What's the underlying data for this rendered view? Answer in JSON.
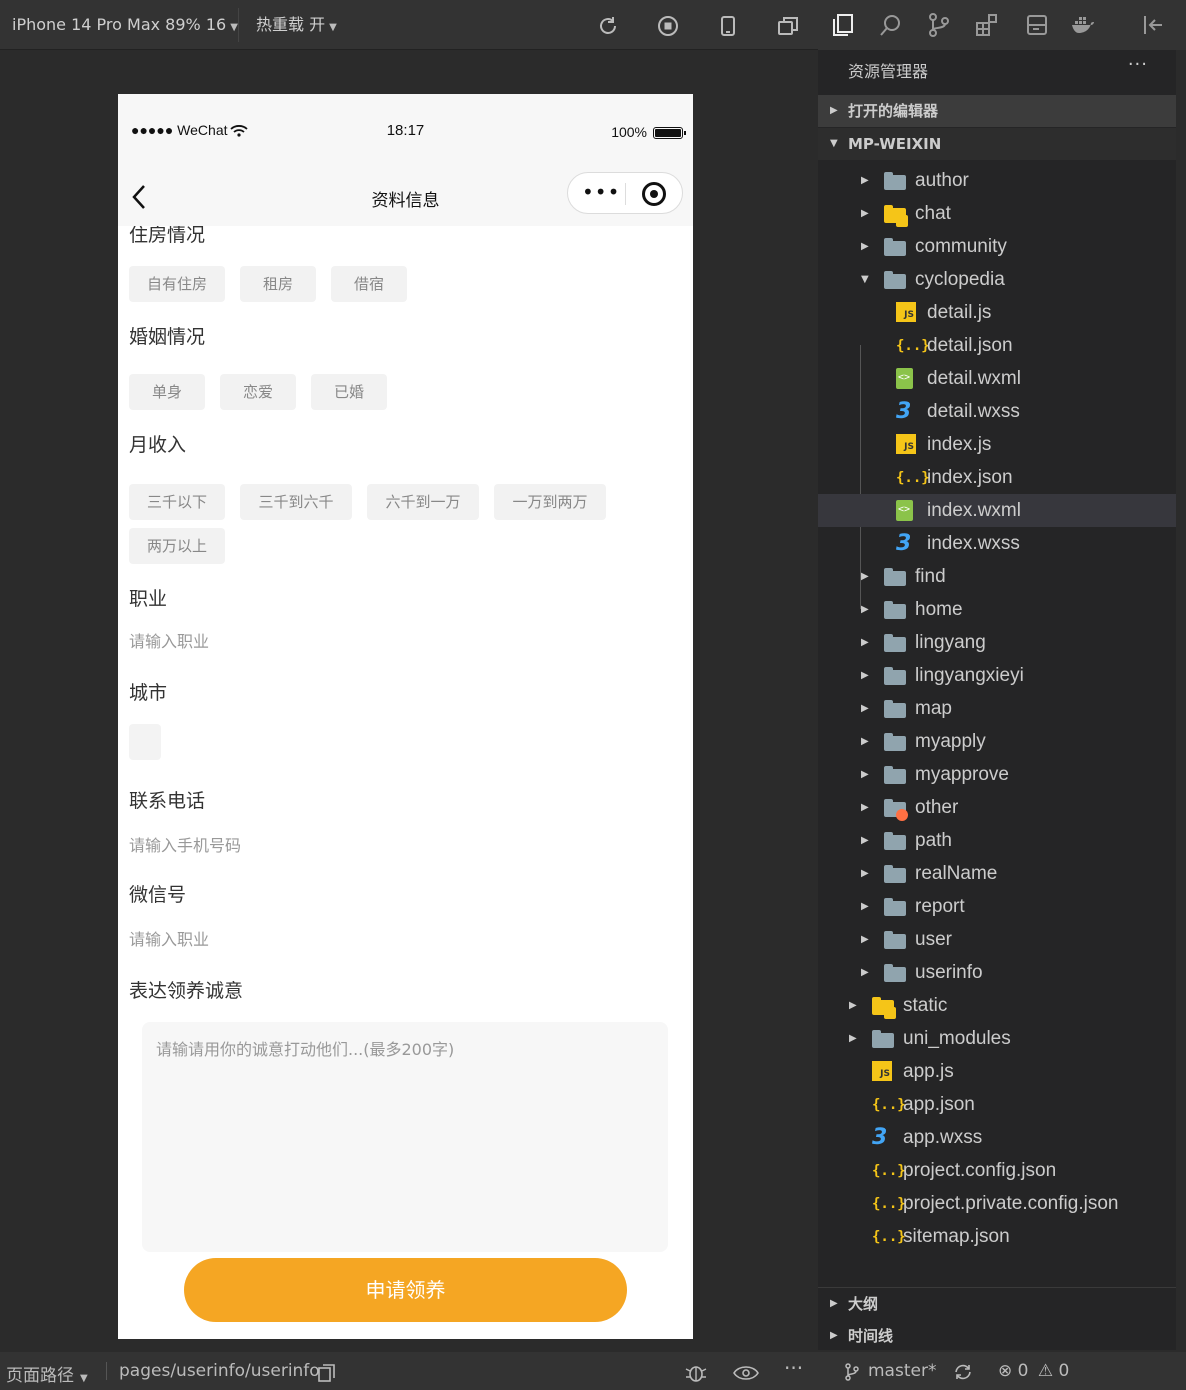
{
  "simulator_toolbar": {
    "device": "iPhone 14 Pro Max 89% 16",
    "hot_reload": "热重载 开",
    "icons": [
      "refresh-icon",
      "stop-icon",
      "phone-icon",
      "window-icon"
    ]
  },
  "phone": {
    "status": {
      "carrier": "●●●●● WeChat",
      "time": "18:17",
      "battery": "100%"
    },
    "nav": {
      "title": "资料信息",
      "more": "•••"
    },
    "sections": {
      "housing": {
        "title": "住房情况",
        "options": [
          "自有住房",
          "租房",
          "借宿"
        ]
      },
      "marriage": {
        "title": "婚姻情况",
        "options": [
          "单身",
          "恋爱",
          "已婚"
        ]
      },
      "income": {
        "title": "月收入",
        "options": [
          "三千以下",
          "三千到六千",
          "六千到一万",
          "一万到两万",
          "两万以上"
        ]
      },
      "job": {
        "title": "职业",
        "placeholder": "请输入职业"
      },
      "city": {
        "title": "城市"
      },
      "phone": {
        "title": "联系电话",
        "placeholder": "请输入手机号码"
      },
      "wechat": {
        "title": "微信号",
        "placeholder": "请输入职业"
      },
      "sincerity": {
        "title": "表达领养诚意",
        "placeholder": "请输请用你的诚意打动他们...(最多200字)"
      }
    },
    "apply_button": "申请领养"
  },
  "bottom_bar": {
    "page_path_label": "页面路径",
    "page_path": "pages/userinfo/userinfo"
  },
  "explorer": {
    "header": "资源管理器",
    "more": "···",
    "open_editors": "打开的编辑器",
    "project": "MP-WEIXIN",
    "items": [
      {
        "name": "author",
        "type": "folder"
      },
      {
        "name": "chat",
        "type": "folder-special"
      },
      {
        "name": "community",
        "type": "folder"
      },
      {
        "name": "cyclopedia",
        "type": "folder-open"
      },
      {
        "name": "detail.js",
        "type": "js"
      },
      {
        "name": "detail.json",
        "type": "json"
      },
      {
        "name": "detail.wxml",
        "type": "wxml"
      },
      {
        "name": "detail.wxss",
        "type": "wxss"
      },
      {
        "name": "index.js",
        "type": "js"
      },
      {
        "name": "index.json",
        "type": "json"
      },
      {
        "name": "index.wxml",
        "type": "wxml"
      },
      {
        "name": "index.wxss",
        "type": "wxss"
      },
      {
        "name": "find",
        "type": "folder"
      },
      {
        "name": "home",
        "type": "folder"
      },
      {
        "name": "lingyang",
        "type": "folder"
      },
      {
        "name": "lingyangxieyi",
        "type": "folder"
      },
      {
        "name": "map",
        "type": "folder"
      },
      {
        "name": "myapply",
        "type": "folder"
      },
      {
        "name": "myapprove",
        "type": "folder"
      },
      {
        "name": "other",
        "type": "folder-other"
      },
      {
        "name": "path",
        "type": "folder"
      },
      {
        "name": "realName",
        "type": "folder"
      },
      {
        "name": "report",
        "type": "folder"
      },
      {
        "name": "user",
        "type": "folder"
      },
      {
        "name": "userinfo",
        "type": "folder"
      },
      {
        "name": "static",
        "type": "folder-static"
      },
      {
        "name": "uni_modules",
        "type": "folder"
      },
      {
        "name": "app.js",
        "type": "js"
      },
      {
        "name": "app.json",
        "type": "json"
      },
      {
        "name": "app.wxss",
        "type": "wxss"
      },
      {
        "name": "project.config.json",
        "type": "json"
      },
      {
        "name": "project.private.config.json",
        "type": "json"
      },
      {
        "name": "sitemap.json",
        "type": "json"
      }
    ],
    "selected": "index.wxml",
    "outline": "大纲",
    "timeline": "时间线",
    "status": {
      "branch": "master*",
      "errors": "0",
      "warnings": "0"
    }
  },
  "colors": {
    "accent": "#f5a623",
    "sidebar_bg": "#252526",
    "selected_row": "#37373d"
  }
}
